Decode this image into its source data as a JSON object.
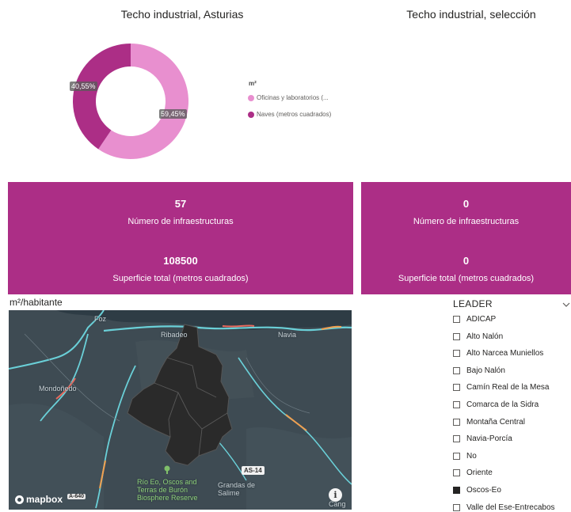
{
  "donut_panel": {
    "title": "Techo industrial, Asturias",
    "legend_title": "m²",
    "legend": [
      {
        "label": "Oficinas y laboratorios (...",
        "color": "#e88fcf"
      },
      {
        "label": "Naves (metros cuadrados)",
        "color": "#ac2e86"
      }
    ],
    "slices": [
      {
        "name": "Oficinas y laboratorios",
        "percent": 59.45,
        "label": "59,45%",
        "color": "#e88fcf"
      },
      {
        "name": "Naves",
        "percent": 40.55,
        "label": "40,55%",
        "color": "#ac2e86"
      }
    ]
  },
  "selection_panel": {
    "title": "Techo industrial, selección"
  },
  "cards_left": {
    "count_value": "57",
    "count_label": "Número de infraestructuras",
    "area_value": "108500",
    "area_label": "Superficie total  (metros cuadrados)"
  },
  "cards_right": {
    "count_value": "0",
    "count_label": "Número de infraestructuras",
    "area_value": "0",
    "area_label": "Superficie total  (metros cuadrados)"
  },
  "map": {
    "title": "m²/habitante",
    "places": {
      "foz": "Foz",
      "ribadeo": "Ribadeo",
      "navia": "Navia",
      "mondonedo": "Mondoñedo",
      "reserve": "Río Eo, Oscos and Terras de Burón Biosphere Reserve",
      "grandas": "Grandas de Salime",
      "cangas": "Cang"
    },
    "road_shield_1": "AS-14",
    "road_shield_2": "A-640",
    "attribution": "mapbox",
    "info_icon": "info-icon"
  },
  "slicer": {
    "title": "LEADER",
    "items": [
      {
        "label": "ADICAP",
        "checked": false
      },
      {
        "label": "Alto Nalón",
        "checked": false
      },
      {
        "label": "Alto Narcea Muniellos",
        "checked": false
      },
      {
        "label": "Bajo Nalón",
        "checked": false
      },
      {
        "label": "Camín Real de la Mesa",
        "checked": false
      },
      {
        "label": "Comarca de la Sidra",
        "checked": false
      },
      {
        "label": "Montaña Central",
        "checked": false
      },
      {
        "label": "Navia-Porcía",
        "checked": false
      },
      {
        "label": "No",
        "checked": false
      },
      {
        "label": "Oriente",
        "checked": false
      },
      {
        "label": "Oscos-Eo",
        "checked": true
      },
      {
        "label": "Valle del Ese-Entrecabos",
        "checked": false
      }
    ]
  }
}
